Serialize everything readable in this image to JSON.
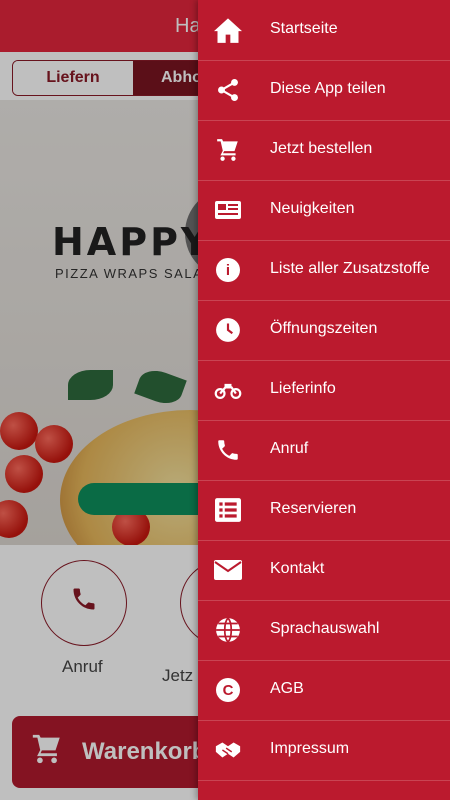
{
  "header": {
    "title_partial": "Ha"
  },
  "toggle": {
    "delivery": "Liefern",
    "pickup": "Abho"
  },
  "hero": {
    "logo": "HAPPY",
    "tagline": "PIZZA WRAPS SALATE"
  },
  "quick_actions": [
    {
      "label": "Anruf",
      "icon": "phone-icon"
    },
    {
      "label": "Jetz",
      "icon": "cart-icon"
    }
  ],
  "cart": {
    "label": "Warenkorb"
  },
  "drawer": {
    "items": [
      {
        "label": "Startseite",
        "icon": "home-icon"
      },
      {
        "label": "Diese App teilen",
        "icon": "share-icon"
      },
      {
        "label": "Jetzt bestellen",
        "icon": "cart-icon"
      },
      {
        "label": "Neuigkeiten",
        "icon": "newspaper-icon"
      },
      {
        "label": "Liste aller Zusatzstoffe",
        "icon": "info-icon"
      },
      {
        "label": "Öffnungszeiten",
        "icon": "clock-icon"
      },
      {
        "label": "Lieferinfo",
        "icon": "motorbike-icon"
      },
      {
        "label": "Anruf",
        "icon": "phone-icon"
      },
      {
        "label": "Reservieren",
        "icon": "list-icon"
      },
      {
        "label": "Kontakt",
        "icon": "envelope-icon"
      },
      {
        "label": "Sprachauswahl",
        "icon": "globe-icon"
      },
      {
        "label": "AGB",
        "icon": "copyright-icon"
      },
      {
        "label": "Impressum",
        "icon": "handshake-icon"
      }
    ]
  },
  "colors": {
    "primary": "#e3263c",
    "drawer": "#bb1a2e",
    "dark": "#7a1420"
  }
}
